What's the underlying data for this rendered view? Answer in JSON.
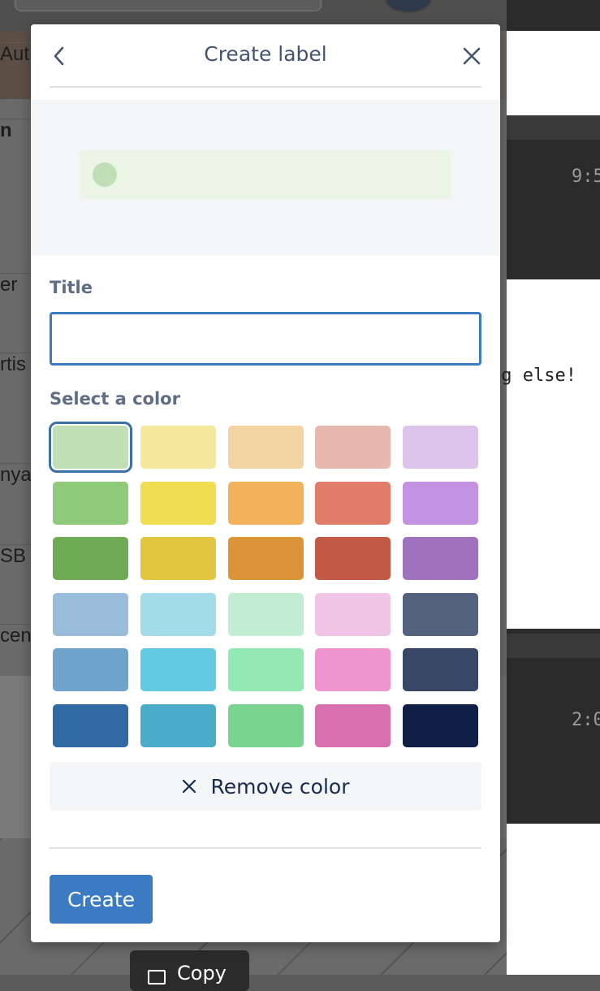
{
  "background": {
    "left_rows": [
      "Aut",
      "n",
      "er",
      "rtis",
      "nyar",
      "SB",
      "cen"
    ],
    "right_times": [
      "9:5",
      "2:0"
    ],
    "right_message": "ng else!",
    "copy_label": "Copy"
  },
  "modal": {
    "title": "Create label",
    "back_icon": "chevron-left-icon",
    "close_icon": "close-icon",
    "title_field": {
      "label": "Title",
      "value": "",
      "placeholder": ""
    },
    "color_section_label": "Select a color",
    "colors": [
      [
        "#c1dfb6",
        "#f3e89b",
        "#f3d3a1",
        "#e7b8ae",
        "#dcc3e9"
      ],
      [
        "#8fc97a",
        "#f1dd52",
        "#f2b15a",
        "#e17c6a",
        "#c492e3"
      ],
      [
        "#6fab53",
        "#e2c63f",
        "#db9538",
        "#c25a45",
        "#a072bd"
      ],
      [
        "#98bcd9",
        "#a4dbe8",
        "#c2edd3",
        "#f0c4e4",
        "#54627d"
      ],
      [
        "#6fa3cb",
        "#63cae3",
        "#92e9b3",
        "#f094d0",
        "#384766"
      ],
      [
        "#2f6aa5",
        "#4bacca",
        "#78d38f",
        "#d86fae",
        "#0f1f45"
      ]
    ],
    "selected_color": "#c1dfb6",
    "remove_color_label": "Remove color",
    "create_label": "Create"
  }
}
